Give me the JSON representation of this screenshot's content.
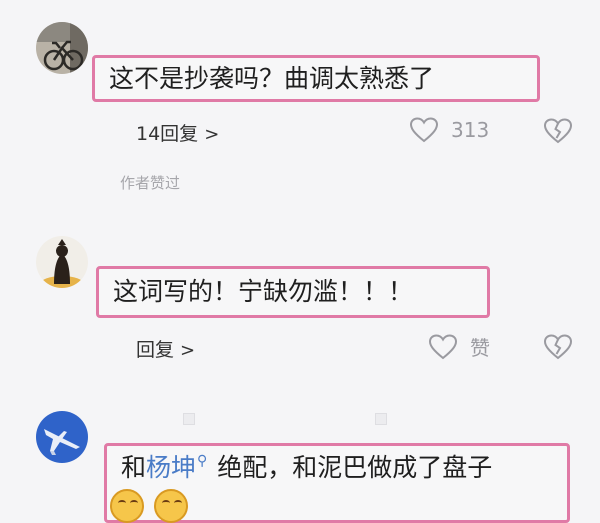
{
  "comments": [
    {
      "text": "这不是抄袭吗？曲调太熟悉了",
      "reply_label": "14回复",
      "like_count": "313",
      "author_liked": "作者赞过",
      "avatar_icon": "bicycle-avatar-icon"
    },
    {
      "text": "这词写的！宁缺勿滥！！！",
      "reply_label": "回复",
      "like_count": "赞",
      "avatar_icon": "silhouette-avatar-icon"
    },
    {
      "text_prefix": "和",
      "mention": "杨坤",
      "text_suffix": "绝配，和泥巴做成了盘子",
      "avatar_icon": "jet-avatar-icon",
      "emojis": [
        "grin-emoji",
        "grin-emoji"
      ]
    }
  ],
  "colors": {
    "highlight_border": "#e07aa6",
    "mention": "#4a7cc7",
    "muted": "#9a9aa0",
    "background": "#f5f5f7"
  }
}
